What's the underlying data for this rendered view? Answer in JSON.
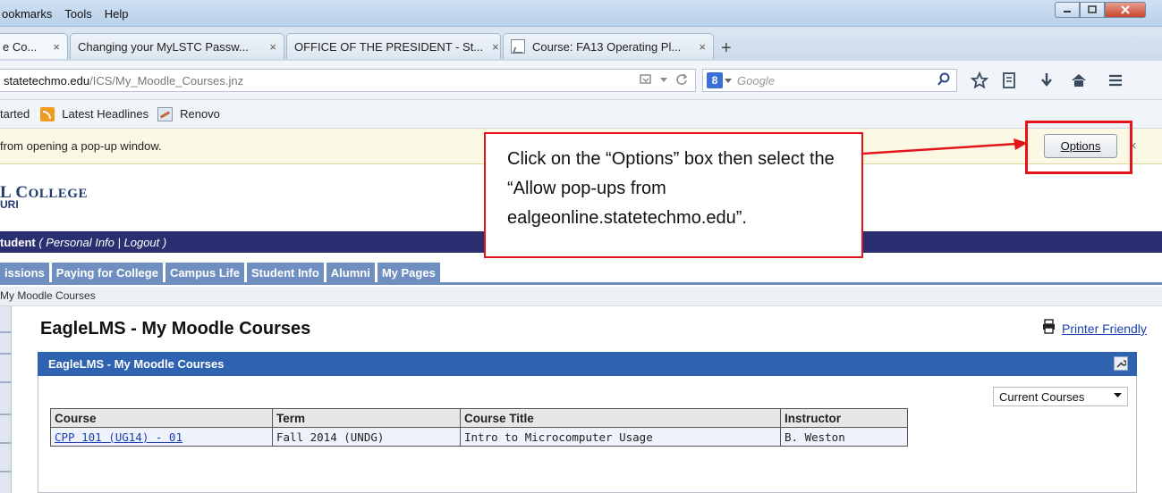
{
  "menu": {
    "items": [
      "ookmarks",
      "Tools",
      "Help"
    ]
  },
  "tabs": [
    {
      "label": "e Co...",
      "close": "×"
    },
    {
      "label": "Changing your MyLSTC Passw...",
      "close": "×"
    },
    {
      "label": "OFFICE OF THE PRESIDENT - St...",
      "close": "×"
    },
    {
      "label": "Course: FA13 Operating Pl...",
      "close": "×"
    }
  ],
  "new_tab": "+",
  "address": {
    "host": "statetechmo.edu",
    "path": "/ICS/My_Moodle_Courses.jnz"
  },
  "search": {
    "engine_letter": "8",
    "placeholder": "Google"
  },
  "bookmarks": {
    "item1": "tarted",
    "item2": "Latest Headlines",
    "item3": "Renovo"
  },
  "popup_bar": {
    "message": " from opening a pop-up window.",
    "options_label": "Options",
    "close": "×"
  },
  "callout": {
    "text": "Click on the “Options” box then select the “Allow pop-ups from ealgeonline.statetechmo.edu”."
  },
  "college": {
    "name_prefix": "L ",
    "name_c": "C",
    "name_rest": "OLLEGE",
    "state": "URI"
  },
  "user_bar": {
    "role": "tudent",
    "open": " ( ",
    "personal_info": "Personal Info",
    "sep": " | ",
    "logout": "Logout",
    "close": " )"
  },
  "nav_tabs": [
    "issions",
    "Paying for College",
    "Campus Life",
    "Student Info",
    "Alumni",
    "My Pages"
  ],
  "breadcrumb": "My Moodle Courses",
  "page_title": "EagleLMS - My Moodle Courses",
  "printer_friendly": "Printer Friendly",
  "portlet": {
    "title": "EagleLMS - My Moodle Courses",
    "term_filter": "Current Courses",
    "columns": [
      "Course",
      "Term",
      "Course Title",
      "Instructor"
    ],
    "rows": [
      {
        "course": "CPP 101 (UG14) - 01",
        "term": "Fall 2014 (UNDG)",
        "title": "Intro to Microcomputer Usage",
        "instructor": "B. Weston"
      }
    ]
  },
  "colors": {
    "accent_red": "#e4141b",
    "header_navy": "#2a2f72",
    "portlet_blue": "#2f63b0",
    "tab_blue": "#6f8fc0"
  },
  "icons": [
    "reader-icon",
    "dropdown-icon",
    "reload-icon",
    "search-icon",
    "star-icon",
    "bookmarks-menu-icon",
    "download-icon",
    "home-icon",
    "hamburger-menu-icon",
    "rss-icon",
    "printer-icon"
  ]
}
